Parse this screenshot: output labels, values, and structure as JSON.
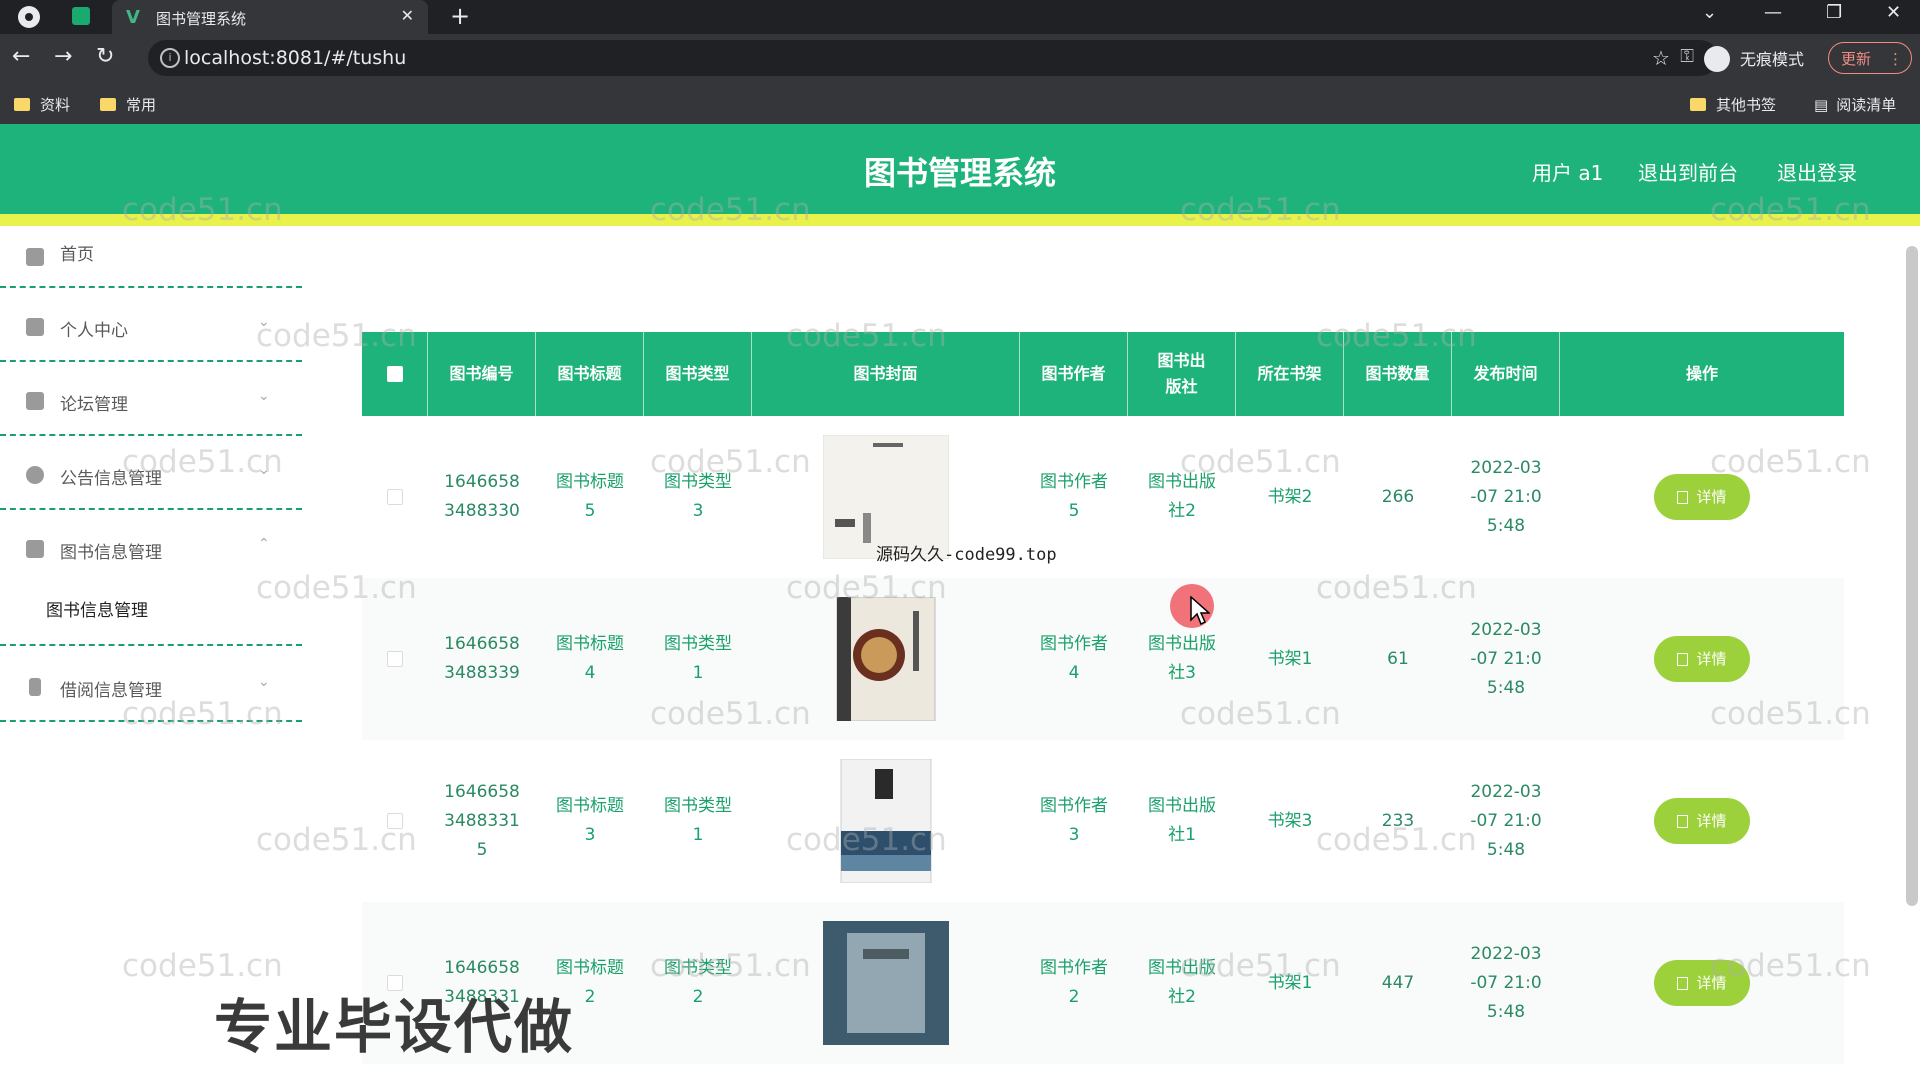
{
  "browser": {
    "tab_title": "图书管理系统",
    "url": "localhost:8081/#/tushu",
    "incognito_label": "无痕模式",
    "update_label": "更新",
    "bookmarks": [
      "资料",
      "常用"
    ],
    "bookmarks_right": [
      "其他书签",
      "阅读清单"
    ]
  },
  "header": {
    "title": "图书管理系统",
    "user": "用户 a1",
    "back_to_front": "退出到前台",
    "logout": "退出登录",
    "color": "#1db37a"
  },
  "sidebar": {
    "items": [
      {
        "label": "首页",
        "icon": "home-icon"
      },
      {
        "label": "个人中心",
        "icon": "user-icon"
      },
      {
        "label": "论坛管理",
        "icon": "forum-icon"
      },
      {
        "label": "公告信息管理",
        "icon": "notice-icon"
      },
      {
        "label": "图书信息管理",
        "icon": "book-icon"
      },
      {
        "label": "借阅信息管理",
        "icon": "borrow-icon"
      }
    ],
    "submenu": "图书信息管理"
  },
  "table": {
    "headers": [
      "图书编号",
      "图书标题",
      "图书类型",
      "图书封面",
      "图书作者",
      "图书出版社",
      "所在书架",
      "图书数量",
      "发布时间",
      "操作"
    ],
    "rows": [
      {
        "id": "1646658 3488330",
        "title": "图书标题 5",
        "type": "图书类型 3",
        "author": "图书作者 5",
        "publisher": "图书出版 社2",
        "shelf": "书架2",
        "count": "266",
        "time": "2022-03 -07 21:0 5:48",
        "action": "详情"
      },
      {
        "id": "1646658 3488339",
        "title": "图书标题 4",
        "type": "图书类型 1",
        "author": "图书作者 4",
        "publisher": "图书出版 社3",
        "shelf": "书架1",
        "count": "61",
        "time": "2022-03 -07 21:0 5:48",
        "action": "详情"
      },
      {
        "id": "1646658 3488331 5",
        "title": "图书标题 3",
        "type": "图书类型 1",
        "author": "图书作者 3",
        "publisher": "图书出版 社1",
        "shelf": "书架3",
        "count": "233",
        "time": "2022-03 -07 21:0 5:48",
        "action": "详情"
      },
      {
        "id": "1646658 3488331",
        "title": "图书标题 2",
        "type": "图书类型 2",
        "author": "图书作者 2",
        "publisher": "图书出版 社2",
        "shelf": "书架1",
        "count": "447",
        "time": "2022-03 -07 21:0 5:48",
        "action": "详情"
      }
    ]
  },
  "overlays": {
    "watermark": "code51.cn",
    "source_text": "源码久久-code99.top",
    "ad_text": "专业毕设代做"
  }
}
